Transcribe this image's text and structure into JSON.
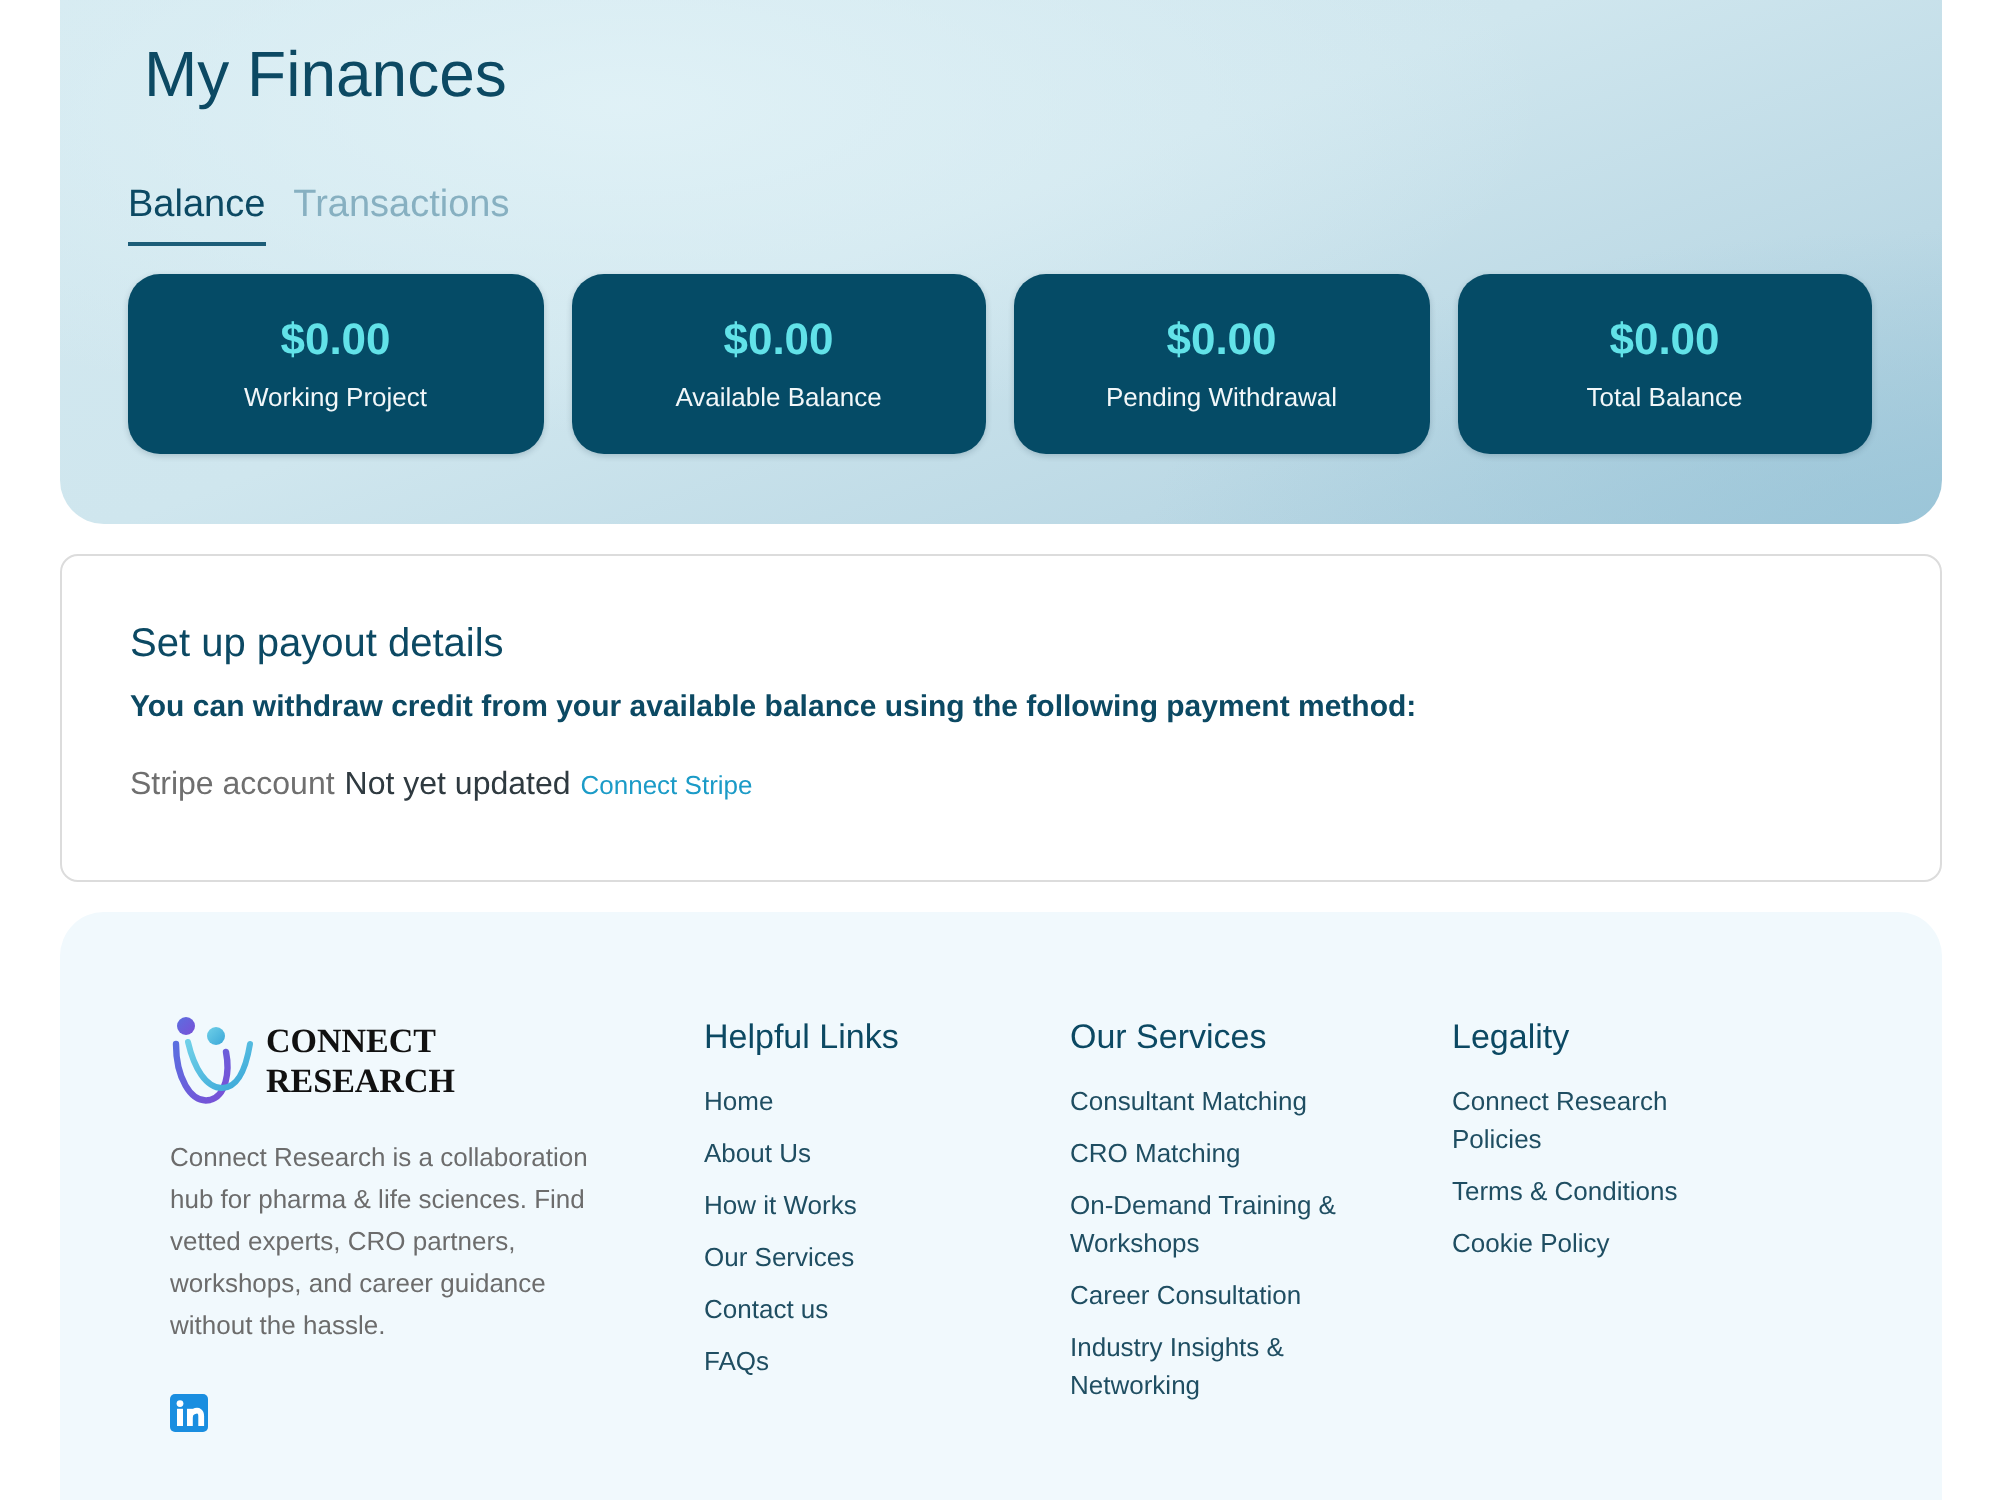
{
  "header": {
    "title": "My Finances"
  },
  "tabs": [
    {
      "label": "Balance",
      "selected": true
    },
    {
      "label": "Transactions",
      "selected": false
    }
  ],
  "balance_cards": [
    {
      "amount": "$0.00",
      "label": "Working Project"
    },
    {
      "amount": "$0.00",
      "label": "Available Balance"
    },
    {
      "amount": "$0.00",
      "label": "Pending Withdrawal"
    },
    {
      "amount": "$0.00",
      "label": "Total Balance"
    }
  ],
  "payout": {
    "heading": "Set up payout details",
    "intro": "You can withdraw credit from your available balance using the following payment method:",
    "methods": [
      {
        "label": "Stripe account",
        "status": "Not yet updated",
        "action": "Connect Stripe"
      }
    ]
  },
  "footer": {
    "brand": {
      "lines": [
        "CONNECT",
        "RESEARCH"
      ]
    },
    "description": "Connect Research is a collaboration hub for pharma & life sciences. Find vetted experts, CRO partners, workshops, and career guidance without the hassle.",
    "social": [
      {
        "kind": "linkedin"
      }
    ],
    "columns": [
      {
        "heading": "Helpful Links",
        "links": [
          "Home",
          "About Us",
          "How it Works",
          "Our Services",
          "Contact us",
          "FAQs"
        ]
      },
      {
        "heading": "Our Services",
        "links": [
          "Consultant Matching",
          "CRO Matching",
          "On-Demand Training & Workshops",
          "Career Consultation",
          "Industry Insights & Networking"
        ]
      },
      {
        "heading": "Legality",
        "links": [
          "Connect Research Policies",
          "Terms & Conditions",
          "Cookie Policy"
        ]
      }
    ]
  }
}
